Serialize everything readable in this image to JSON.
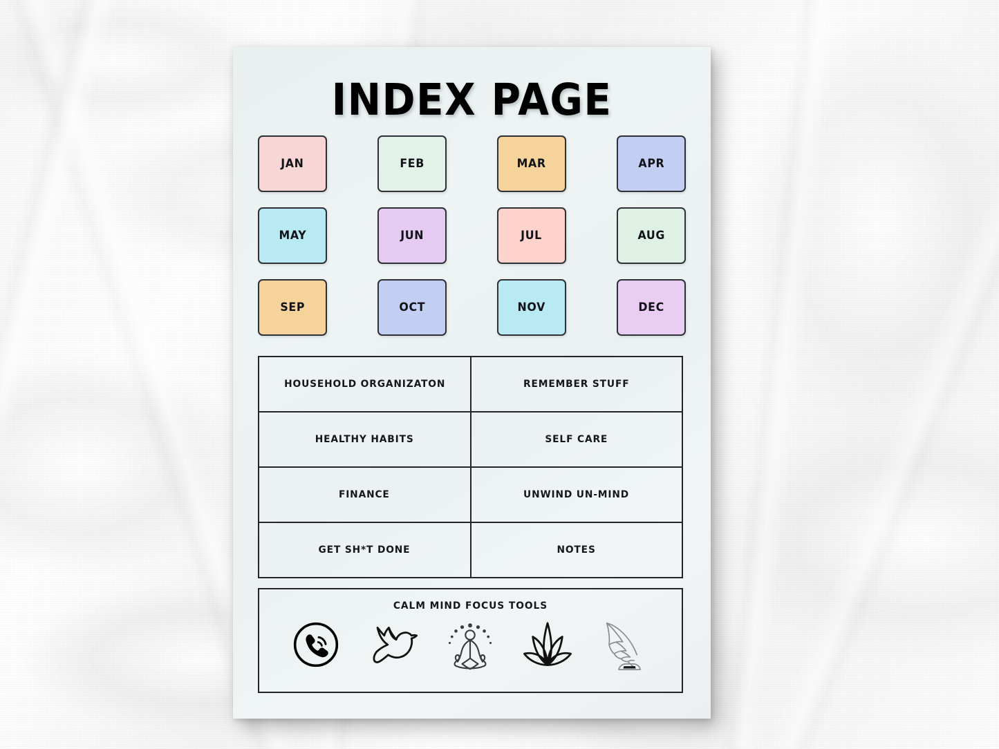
{
  "page": {
    "title": "INDEX PAGE",
    "paper_color": "#eef3f3",
    "background": "white-textured-plaster-wall"
  },
  "months": [
    {
      "label": "JAN",
      "color": "#f9d6d6"
    },
    {
      "label": "FEB",
      "color": "#e3f2e8"
    },
    {
      "label": "MAR",
      "color": "#f7d39c"
    },
    {
      "label": "APR",
      "color": "#c2cff3"
    },
    {
      "label": "MAY",
      "color": "#b9eaf3"
    },
    {
      "label": "JUN",
      "color": "#e5caf2"
    },
    {
      "label": "JUL",
      "color": "#fdd3cc"
    },
    {
      "label": "AUG",
      "color": "#dff0e4"
    },
    {
      "label": "SEP",
      "color": "#f7d39c"
    },
    {
      "label": "OCT",
      "color": "#c2cff3"
    },
    {
      "label": "NOV",
      "color": "#b9eaf3"
    },
    {
      "label": "DEC",
      "color": "#e9cdf3"
    }
  ],
  "sections": {
    "rows": [
      {
        "left": "HOUSEHOLD ORGANIZATON",
        "right": "REMEMBER STUFF"
      },
      {
        "left": "HEALTHY HABITS",
        "right": "SELF CARE"
      },
      {
        "left": "FINANCE",
        "right": "UNWIND UN-MIND"
      },
      {
        "left": "GET SH*T DONE",
        "right": "NOTES"
      }
    ]
  },
  "focus_tools": {
    "title": "CALM MIND FOCUS TOOLS",
    "icons": [
      "phone-call-icon",
      "dove-icon",
      "meditation-icon",
      "lotus-plant-icon",
      "quill-inkwell-icon"
    ]
  }
}
